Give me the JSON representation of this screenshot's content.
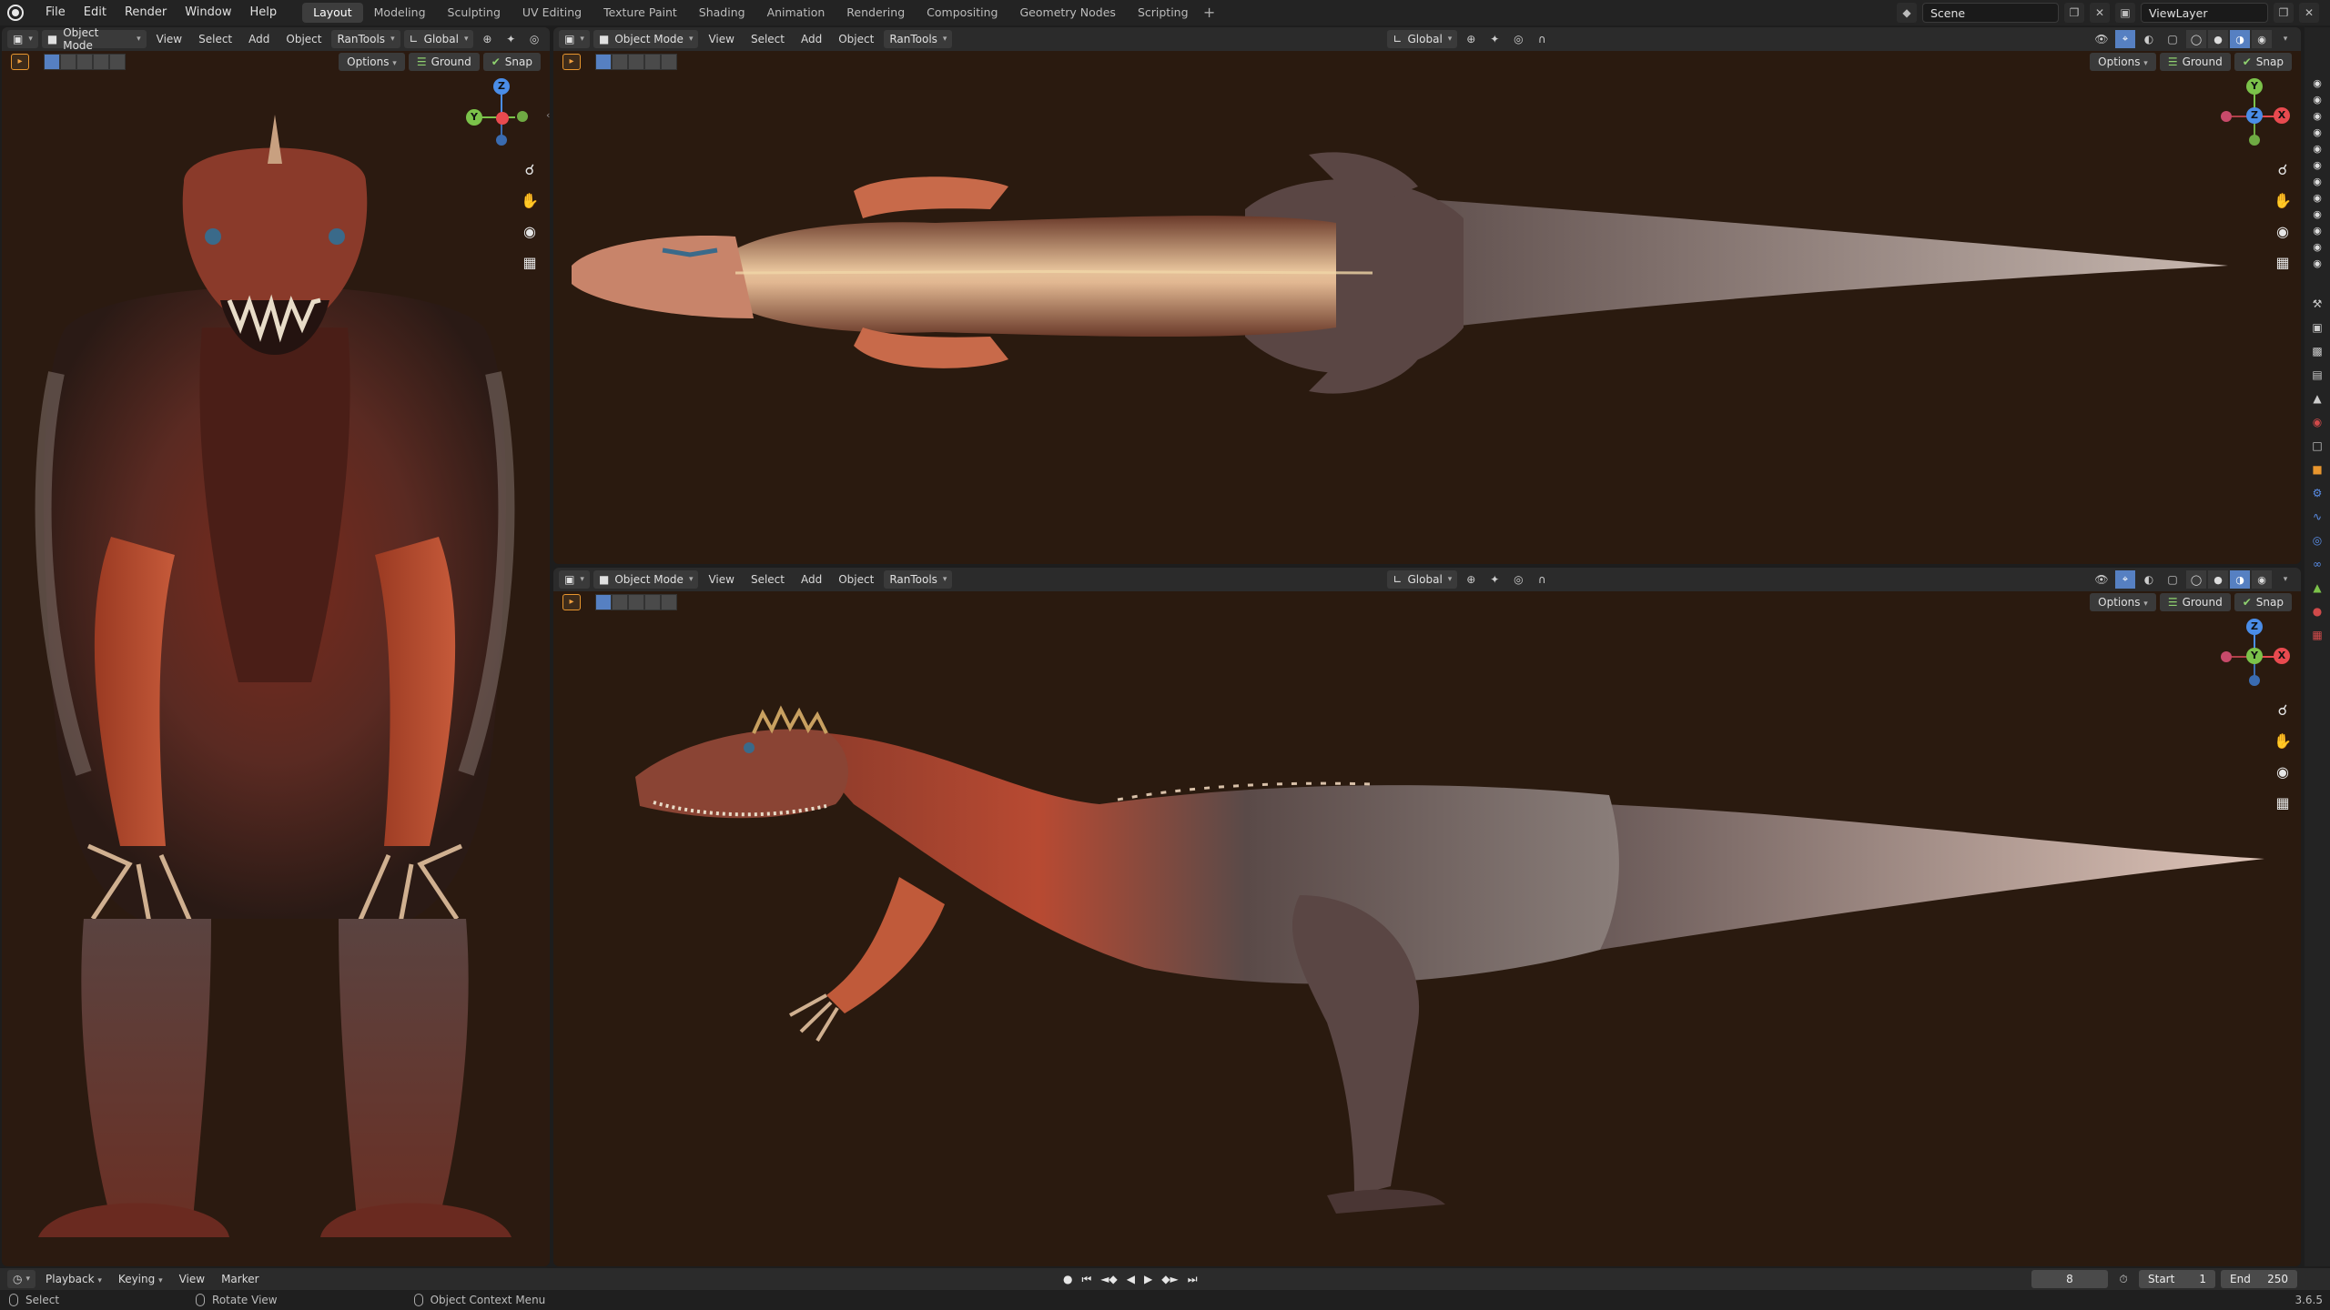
{
  "menu": {
    "items": [
      "File",
      "Edit",
      "Render",
      "Window",
      "Help"
    ]
  },
  "workspaces": {
    "tabs": [
      "Layout",
      "Modeling",
      "Sculpting",
      "UV Editing",
      "Texture Paint",
      "Shading",
      "Animation",
      "Rendering",
      "Compositing",
      "Geometry Nodes",
      "Scripting"
    ],
    "active": "Layout"
  },
  "scene": {
    "name": "Scene"
  },
  "view_layer": {
    "name": "ViewLayer"
  },
  "viewport_header": {
    "mode": "Object Mode",
    "view": "View",
    "select": "Select",
    "add": "Add",
    "object": "Object",
    "addon": "RanTools",
    "orientation": "Global"
  },
  "viewport_subheader": {
    "options": "Options",
    "ground": "Ground",
    "snap": "Snap"
  },
  "gizmo_labels": {
    "x": "X",
    "y": "Y",
    "z": "Z"
  },
  "timeline": {
    "playback": "Playback",
    "keying": "Keying",
    "view": "View",
    "marker": "Marker",
    "current_frame": "8",
    "start_label": "Start",
    "start": "1",
    "end_label": "End",
    "end": "250"
  },
  "status": {
    "select": "Select",
    "rotate": "Rotate View",
    "context": "Object Context Menu",
    "version": "3.6.5"
  },
  "icons": {
    "zoom": "zoom-icon",
    "pan": "hand-icon",
    "camera": "camera-icon",
    "ortho": "grid-icon"
  },
  "colors": {
    "viewport_bg": "#2a1a0f",
    "accent": "#5680c2",
    "gizmo_x": "#e84a4f",
    "gizmo_y": "#7bc24a",
    "gizmo_z": "#4a8de8"
  }
}
